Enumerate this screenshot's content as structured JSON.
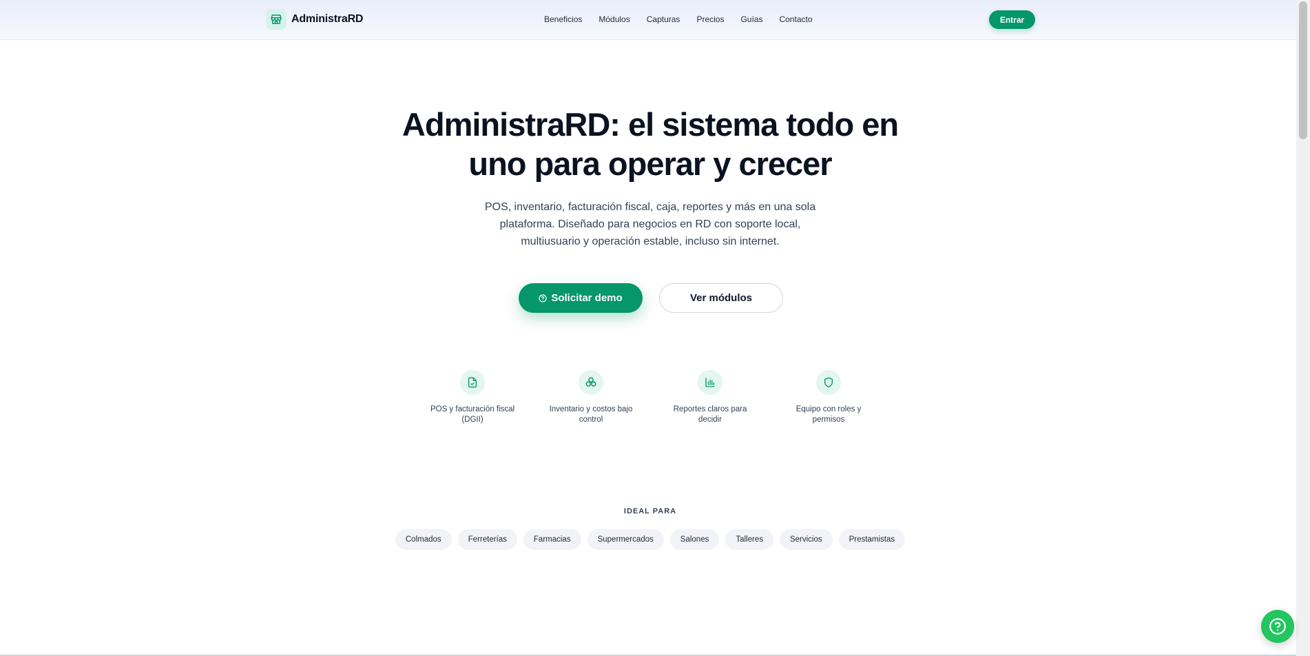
{
  "brand": {
    "name": "AdministraRD",
    "icon": "storefront-icon"
  },
  "nav": {
    "items": [
      "Beneficios",
      "Módulos",
      "Capturas",
      "Precios",
      "Guías",
      "Contacto"
    ],
    "login_label": "Entrar"
  },
  "hero": {
    "title": "AdministraRD: el sistema todo en uno para operar y crecer",
    "subtitle": "POS, inventario, facturación fiscal, caja, reportes y más en una sola plataforma. Diseñado para negocios en RD con soporte local, multiusuario y operación estable, incluso sin internet.",
    "primary_button": "Solicitar demo",
    "secondary_button": "Ver módulos"
  },
  "features": [
    {
      "label": "POS y facturación fiscal (DGII)",
      "icon": "invoice-check-icon"
    },
    {
      "label": "Inventario y costos bajo control",
      "icon": "boxes-icon"
    },
    {
      "label": "Reportes claros para decidir",
      "icon": "bar-chart-icon"
    },
    {
      "label": "Equipo con roles y permisos",
      "icon": "shield-icon"
    }
  ],
  "ideal": {
    "heading": "IDEAL PARA",
    "chips": [
      "Colmados",
      "Ferreterías",
      "Farmacias",
      "Supermercados",
      "Salones",
      "Talleres",
      "Servicios",
      "Prestamistas"
    ]
  },
  "colors": {
    "accent": "#059669",
    "help_button": "#22c55e",
    "icon_bg": "#e3f6ef"
  }
}
